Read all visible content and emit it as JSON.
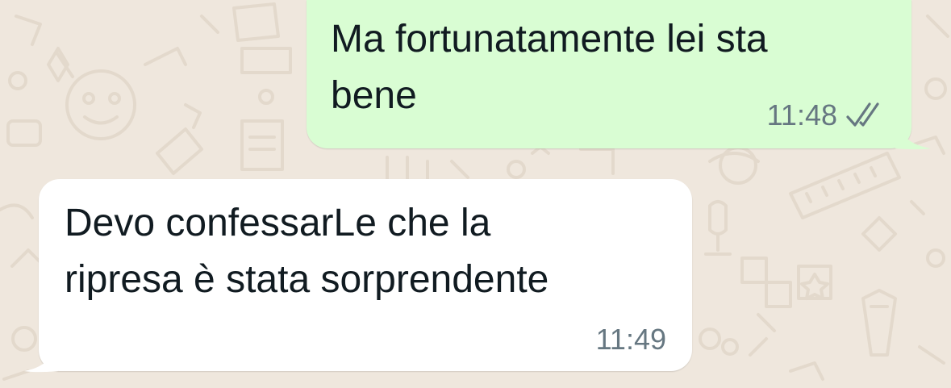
{
  "chat": {
    "background_color": "#efe7dd",
    "messages": [
      {
        "direction": "outgoing",
        "lines": [
          "Ma fortunatamente lei sta",
          "bene"
        ],
        "time": "11:48",
        "status_icon": "double-check-icon",
        "bubble_color": "#d9fdd3"
      },
      {
        "direction": "incoming",
        "lines": [
          "Devo confessarLe che la",
          "ripresa è stata sorprendente"
        ],
        "time": "11:49",
        "bubble_color": "#ffffff"
      }
    ]
  }
}
